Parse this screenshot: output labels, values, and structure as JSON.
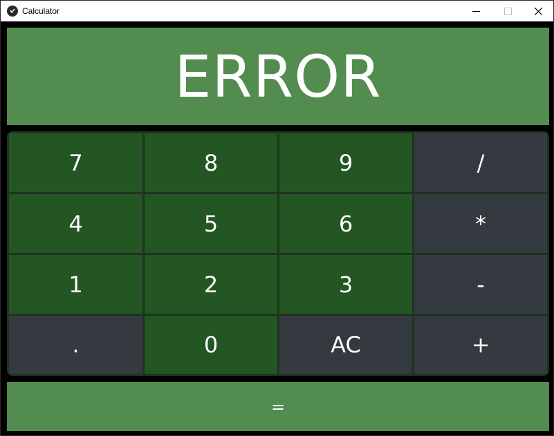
{
  "window": {
    "title": "Calculator",
    "controls": {
      "minimize": "minimize",
      "maximize": "maximize",
      "close": "close"
    }
  },
  "display": {
    "value": "ERROR"
  },
  "keypad": {
    "rows": [
      [
        {
          "label": "7",
          "kind": "num"
        },
        {
          "label": "8",
          "kind": "num"
        },
        {
          "label": "9",
          "kind": "num"
        },
        {
          "label": "/",
          "kind": "op"
        }
      ],
      [
        {
          "label": "4",
          "kind": "num"
        },
        {
          "label": "5",
          "kind": "num"
        },
        {
          "label": "6",
          "kind": "num"
        },
        {
          "label": "*",
          "kind": "op"
        }
      ],
      [
        {
          "label": "1",
          "kind": "num"
        },
        {
          "label": "2",
          "kind": "num"
        },
        {
          "label": "3",
          "kind": "num"
        },
        {
          "label": "-",
          "kind": "op"
        }
      ],
      [
        {
          "label": ".",
          "kind": "op"
        },
        {
          "label": "0",
          "kind": "num"
        },
        {
          "label": "AC",
          "kind": "op"
        },
        {
          "label": "+",
          "kind": "op"
        }
      ]
    ]
  },
  "equals": {
    "label": "="
  },
  "colors": {
    "display_bg": "#528c4f",
    "number_key": "#235622",
    "operator_key": "#343a40",
    "keypad_bg": "#1e3320",
    "text": "#ffffff"
  }
}
